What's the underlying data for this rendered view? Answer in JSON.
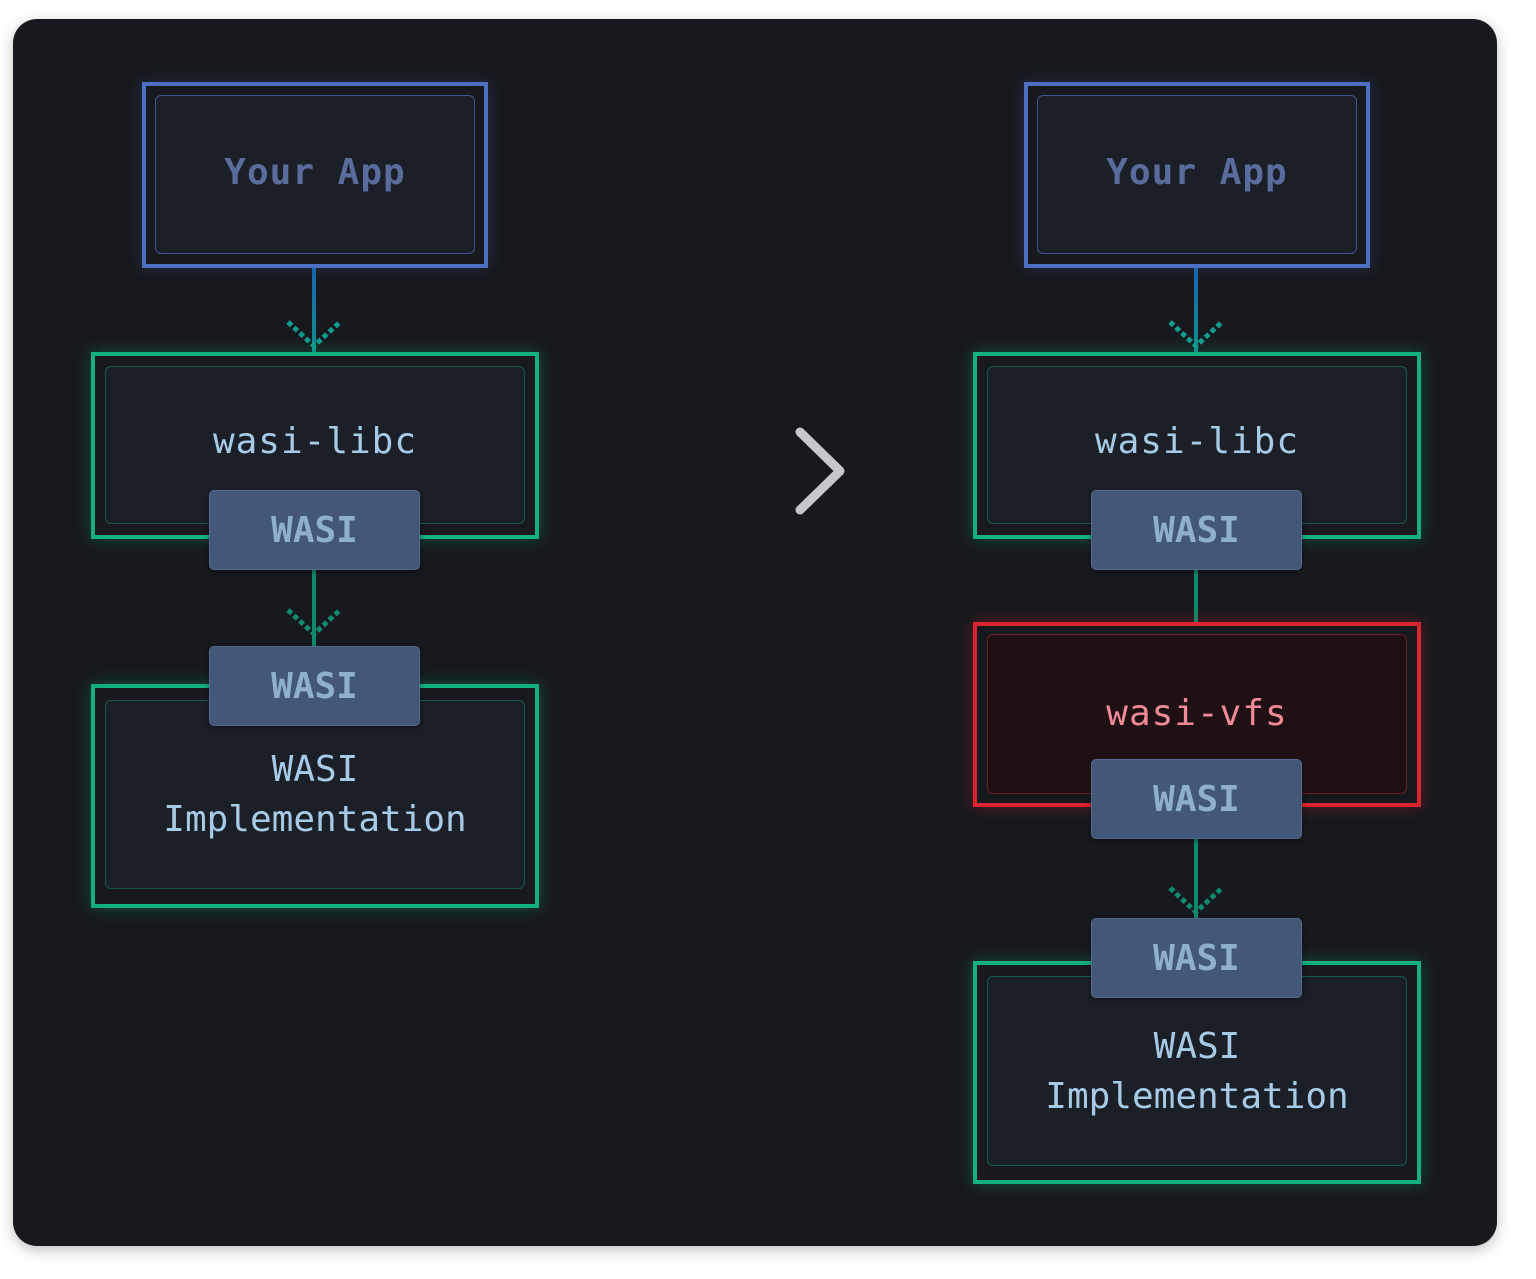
{
  "before": {
    "app": {
      "label": "Your App"
    },
    "libc": {
      "label": "wasi-libc",
      "interface": "WASI"
    },
    "impl": {
      "interface": "WASI",
      "label_line1": "WASI",
      "label_line2": "Implementation"
    }
  },
  "after": {
    "app": {
      "label": "Your App"
    },
    "libc": {
      "label": "wasi-libc",
      "interface": "WASI"
    },
    "vfs": {
      "label": "wasi-vfs",
      "interface": "WASI"
    },
    "impl": {
      "interface": "WASI",
      "label_line1": "WASI",
      "label_line2": "Implementation"
    }
  },
  "colors": {
    "app": "#4e6fc4",
    "libc": "#10b17f",
    "vfs": "#dc2430",
    "badge": "#435778",
    "background": "#17191e"
  },
  "transition_icon": "arrow-right-icon"
}
